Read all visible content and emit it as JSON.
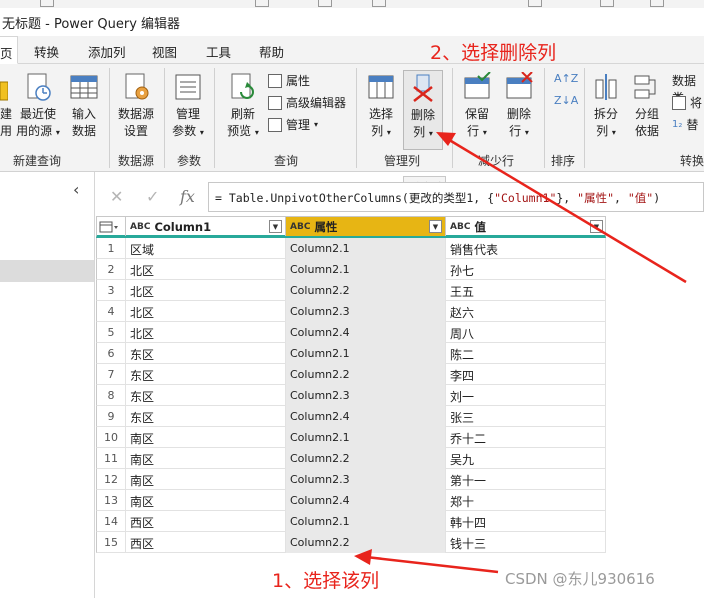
{
  "window": {
    "title": "无标题 - Power Query 编辑器"
  },
  "menu": {
    "tabs": [
      {
        "label": "页"
      },
      {
        "label": "转换"
      },
      {
        "label": "添加列"
      },
      {
        "label": "视图"
      },
      {
        "label": "工具"
      },
      {
        "label": "帮助"
      }
    ]
  },
  "ribbon": {
    "new_query": {
      "label": "新建查询",
      "partial_btn_1": "建",
      "partial_btn_2": "用",
      "recent_line1": "最近使",
      "recent_line2": "用的源",
      "enter_line1": "输入",
      "enter_line2": "数据"
    },
    "data_source": {
      "label": "数据源",
      "settings_line1": "数据源",
      "settings_line2": "设置"
    },
    "params": {
      "label": "参数",
      "manage_line1": "管理",
      "manage_line2": "参数"
    },
    "query": {
      "label": "查询",
      "refresh_line1": "刷新",
      "refresh_line2": "预览",
      "properties": "属性",
      "advanced_editor": "高级编辑器",
      "manage": "管理"
    },
    "manage_columns": {
      "label": "管理列",
      "choose_line1": "选择",
      "choose_line2": "列",
      "remove_line1": "删除",
      "remove_line2": "列"
    },
    "reduce_rows": {
      "label": "减少行",
      "keep_line1": "保留",
      "keep_line2": "行",
      "remove_line1": "删除",
      "remove_line2": "行"
    },
    "sort": {
      "label": "排序"
    },
    "transform": {
      "label": "转换",
      "split_line1": "拆分",
      "split_line2": "列",
      "group_line1": "分组",
      "group_line2": "依据",
      "datatype": "数据类",
      "use_first_row": "将",
      "replace": "替"
    },
    "tooltip": "删除列"
  },
  "annotations": {
    "step2": "2、选择删除列",
    "step1": "1、选择该列"
  },
  "formula": {
    "cancel": "✕",
    "confirm": "✓",
    "fx": "fx",
    "prefix": "= Table.UnpivotOtherColumns(更改的类型1, {",
    "str1": "\"Column1\"",
    "mid1": "}, ",
    "str2": "\"属性\"",
    "mid2": ", ",
    "str3": "\"值\"",
    "suffix": ")"
  },
  "grid": {
    "columns": [
      {
        "type": "ABC",
        "name": "Column1"
      },
      {
        "type": "ABC",
        "name": "属性"
      },
      {
        "type": "ABC",
        "name": "值"
      }
    ],
    "rows": [
      {
        "idx": "1",
        "region": "区域",
        "attr": "Column2.1",
        "val": "销售代表"
      },
      {
        "idx": "2",
        "region": "北区",
        "attr": "Column2.1",
        "val": "孙七"
      },
      {
        "idx": "3",
        "region": "北区",
        "attr": "Column2.2",
        "val": "王五"
      },
      {
        "idx": "4",
        "region": "北区",
        "attr": "Column2.3",
        "val": "赵六"
      },
      {
        "idx": "5",
        "region": "北区",
        "attr": "Column2.4",
        "val": "周八"
      },
      {
        "idx": "6",
        "region": "东区",
        "attr": "Column2.1",
        "val": "陈二"
      },
      {
        "idx": "7",
        "region": "东区",
        "attr": "Column2.2",
        "val": "李四"
      },
      {
        "idx": "8",
        "region": "东区",
        "attr": "Column2.3",
        "val": "刘一"
      },
      {
        "idx": "9",
        "region": "东区",
        "attr": "Column2.4",
        "val": "张三"
      },
      {
        "idx": "10",
        "region": "南区",
        "attr": "Column2.1",
        "val": "乔十二"
      },
      {
        "idx": "11",
        "region": "南区",
        "attr": "Column2.2",
        "val": "吴九"
      },
      {
        "idx": "12",
        "region": "南区",
        "attr": "Column2.3",
        "val": "第十一"
      },
      {
        "idx": "13",
        "region": "南区",
        "attr": "Column2.4",
        "val": "郑十"
      },
      {
        "idx": "14",
        "region": "西区",
        "attr": "Column2.1",
        "val": "韩十四"
      },
      {
        "idx": "15",
        "region": "西区",
        "attr": "Column2.2",
        "val": "钱十三"
      }
    ]
  },
  "watermark": "CSDN @东儿930616",
  "colors": {
    "selected_header": "#e7b514",
    "header_underline": "#28a99a",
    "annotation_red": "#e8241c",
    "ribbon_bg": "#f3f3f3"
  }
}
